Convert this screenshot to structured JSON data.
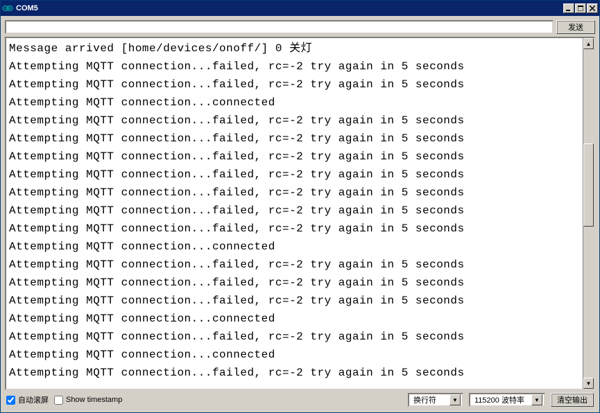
{
  "titlebar": {
    "title": "COM5"
  },
  "input": {
    "value": "",
    "send_button": "发送"
  },
  "output": {
    "lines": [
      "Message arrived [home/devices/onoff/] 0 关灯",
      "Attempting MQTT connection...failed, rc=-2 try again in 5 seconds",
      "Attempting MQTT connection...failed, rc=-2 try again in 5 seconds",
      "Attempting MQTT connection...connected",
      "Attempting MQTT connection...failed, rc=-2 try again in 5 seconds",
      "Attempting MQTT connection...failed, rc=-2 try again in 5 seconds",
      "Attempting MQTT connection...failed, rc=-2 try again in 5 seconds",
      "Attempting MQTT connection...failed, rc=-2 try again in 5 seconds",
      "Attempting MQTT connection...failed, rc=-2 try again in 5 seconds",
      "Attempting MQTT connection...failed, rc=-2 try again in 5 seconds",
      "Attempting MQTT connection...failed, rc=-2 try again in 5 seconds",
      "Attempting MQTT connection...connected",
      "Attempting MQTT connection...failed, rc=-2 try again in 5 seconds",
      "Attempting MQTT connection...failed, rc=-2 try again in 5 seconds",
      "Attempting MQTT connection...failed, rc=-2 try again in 5 seconds",
      "Attempting MQTT connection...connected",
      "Attempting MQTT connection...failed, rc=-2 try again in 5 seconds",
      "Attempting MQTT connection...connected",
      "Attempting MQTT connection...failed, rc=-2 try again in 5 seconds"
    ]
  },
  "bottom": {
    "autoscroll_label": "自动滚屏",
    "autoscroll_checked": true,
    "timestamp_label": "Show timestamp",
    "timestamp_checked": false,
    "line_ending": "换行符",
    "baud_rate": "115200 波特率",
    "clear_button": "清空输出"
  }
}
